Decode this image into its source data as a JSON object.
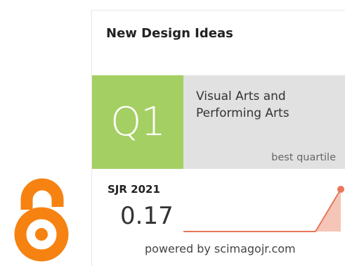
{
  "logo": {
    "name": "open-access-icon",
    "color": "#f68212"
  },
  "widget": {
    "journal_title": "New Design Ideas",
    "quartile": "Q1",
    "quartile_color": "#a4cf63",
    "subject_area_lines": [
      "Visual Arts and",
      "Performing Arts"
    ],
    "quartile_caption": "best quartile",
    "sjr_label": "SJR 2021",
    "sjr_value": "0.17",
    "powered_by": "powered by scimagojr.com",
    "trend_color": "#e8775a"
  }
}
